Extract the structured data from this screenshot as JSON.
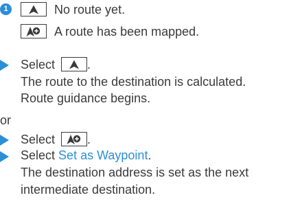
{
  "status_block": {
    "number": "1",
    "line1_text": "No route yet.",
    "line2_text": "A route has been mapped."
  },
  "step_group_1": {
    "select_prefix": "Select",
    "select_suffix": ".",
    "result_line1": "The route to the destination is calculated.",
    "result_line2": "Route guidance begins."
  },
  "separator": "or",
  "step_group_2": {
    "select_prefix": "Select",
    "select_suffix": ".",
    "step2_prefix": "Select",
    "step2_link": "Set as Waypoint",
    "step2_suffix": ".",
    "result_line1": "The destination address is set as the next",
    "result_line2": "intermediate destination."
  },
  "icons": {
    "navigation_arrow": "navigation-arrow-icon",
    "navigation_arrow_plus": "navigation-arrow-plus-icon"
  },
  "colors": {
    "accent": "#2b8fd6",
    "text": "#3a3a3a"
  }
}
